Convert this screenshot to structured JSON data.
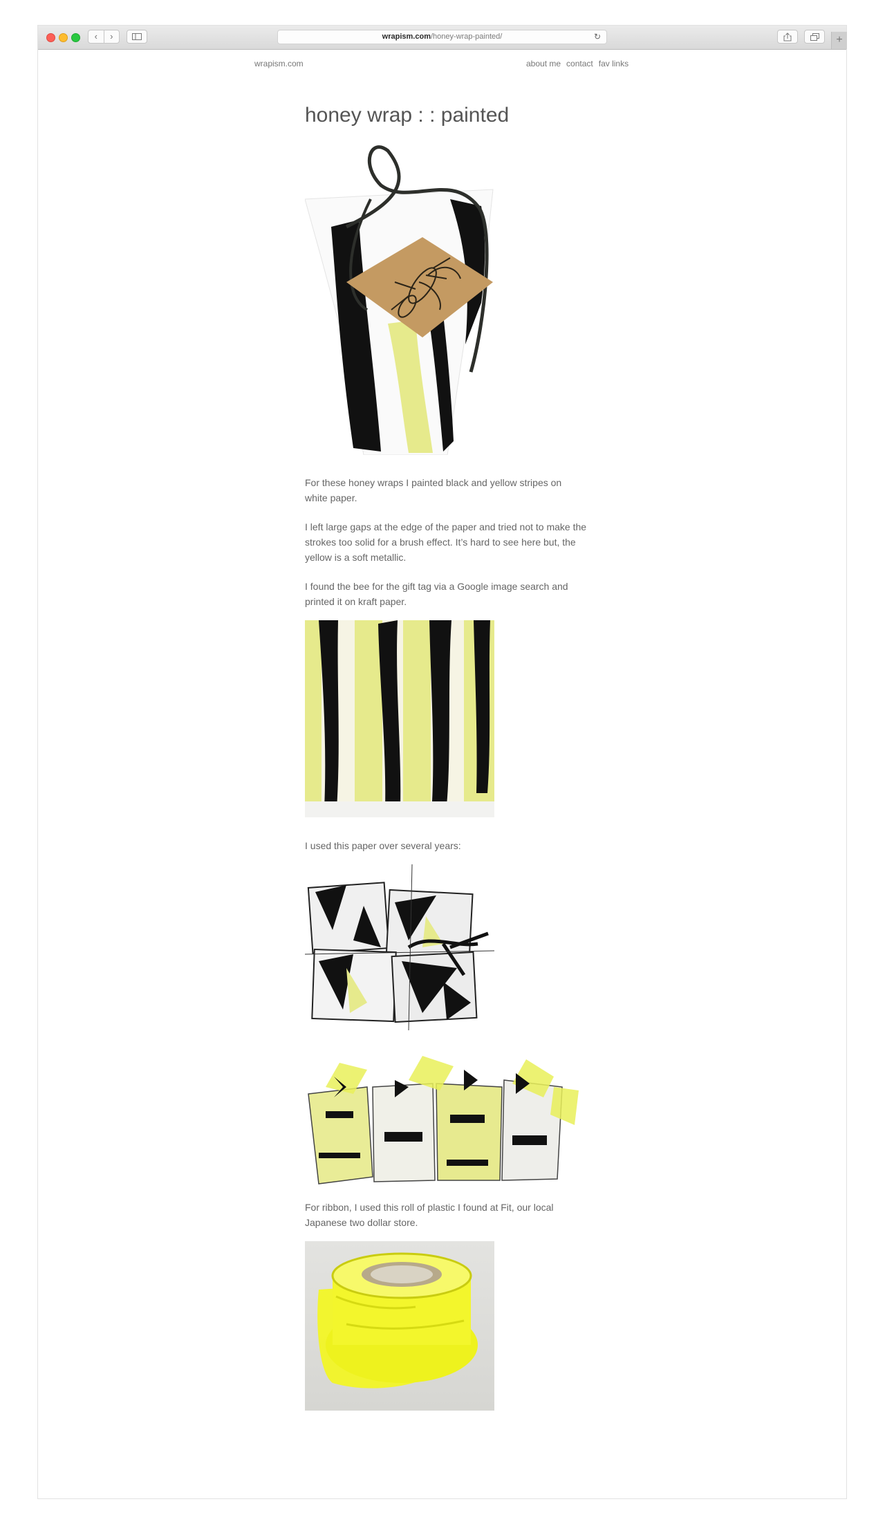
{
  "browser": {
    "url_domain": "wrapism.com",
    "url_path": "/honey-wrap-painted/",
    "reload_glyph": "↻",
    "back_glyph": "‹",
    "forward_glyph": "›",
    "new_tab_glyph": "+"
  },
  "site": {
    "brand": "wrapism.com",
    "nav": [
      "about me",
      "contact",
      "fav links"
    ]
  },
  "post": {
    "title": "honey wrap : : painted",
    "paragraphs": [
      "For these honey wraps I painted black and yellow stripes on white paper.",
      "I left large gaps at the edge of the paper and tried not to make the strokes too solid for a brush effect. It’s hard to see here but, the yellow is a soft metallic.",
      "I found the bee for the gift tag via a Google image search and printed it on kraft paper.",
      "I used this paper over several years:",
      "For ribbon, I used this roll of plastic I found at Fit, our local Japanese two dollar store."
    ]
  },
  "colors": {
    "accent_yellow": "#e6ea8c",
    "stripe_black": "#111111",
    "kraft": "#c49a62",
    "ribbon_yellow": "#f2f526"
  }
}
